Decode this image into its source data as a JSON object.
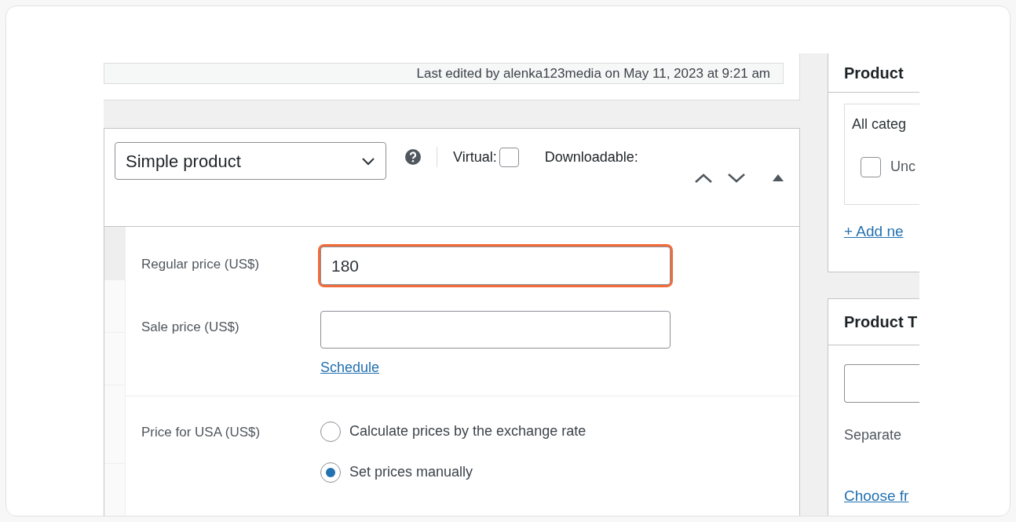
{
  "last_edited": "Last edited by alenka123media on May 11, 2023 at 9:21 am",
  "product_type": {
    "value": "Simple product"
  },
  "virtual": {
    "label": "Virtual:",
    "checked": false
  },
  "downloadable": {
    "label": "Downloadable:"
  },
  "general": {
    "regular_price": {
      "label": "Regular price (US$)",
      "value": "180",
      "highlighted": true
    },
    "sale_price": {
      "label": "Sale price (US$)"
    },
    "schedule_link": "Schedule"
  },
  "usa_price": {
    "label": "Price for USA (US$)",
    "options": [
      {
        "label": "Calculate prices by the exchange rate",
        "selected": false
      },
      {
        "label": "Set prices manually",
        "selected": true
      }
    ]
  },
  "sidebar": {
    "categories": {
      "title": "Product",
      "tab": "All categ",
      "items": [
        {
          "label": "Unc",
          "checked": false
        }
      ],
      "add_link": "+ Add ne"
    },
    "tags": {
      "title": "Product T",
      "hint": "Separate",
      "choose_link": "Choose fr"
    }
  }
}
